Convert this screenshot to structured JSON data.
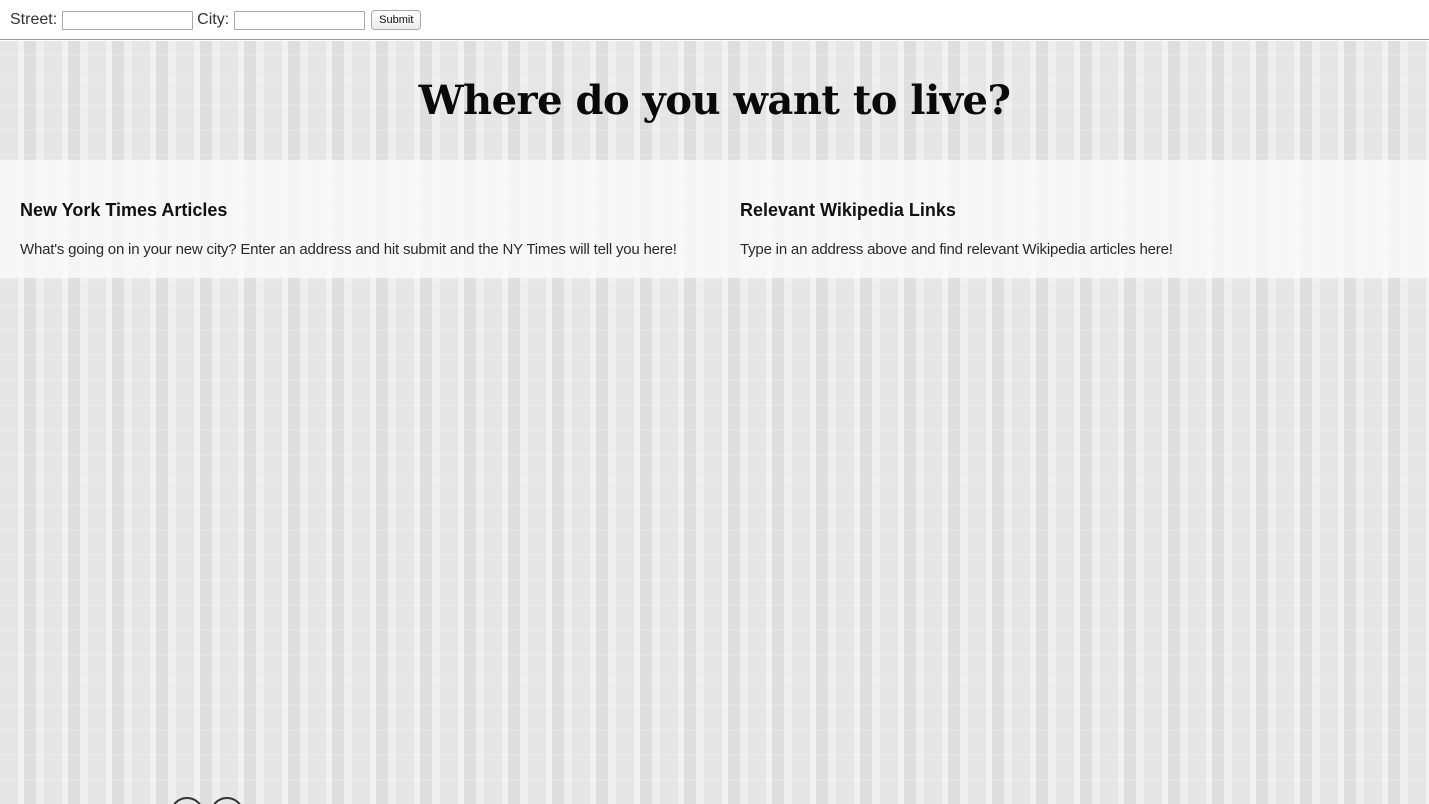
{
  "form": {
    "street_label": "Street:",
    "street_value": "",
    "city_label": "City:",
    "city_value": "",
    "submit_label": "Submit"
  },
  "headline": "Where do you want to live?",
  "sections": {
    "nyt": {
      "title": "New York Times Articles",
      "body": "What's going on in your new city? Enter an address and hit submit and the NY Times will tell you here!"
    },
    "wiki": {
      "title": "Relevant Wikipedia Links",
      "body": "Type in an address above and find relevant Wikipedia articles here!"
    }
  },
  "colors": {
    "background": "#e9e9e9",
    "band": "#fafafa",
    "text": "#111111"
  }
}
